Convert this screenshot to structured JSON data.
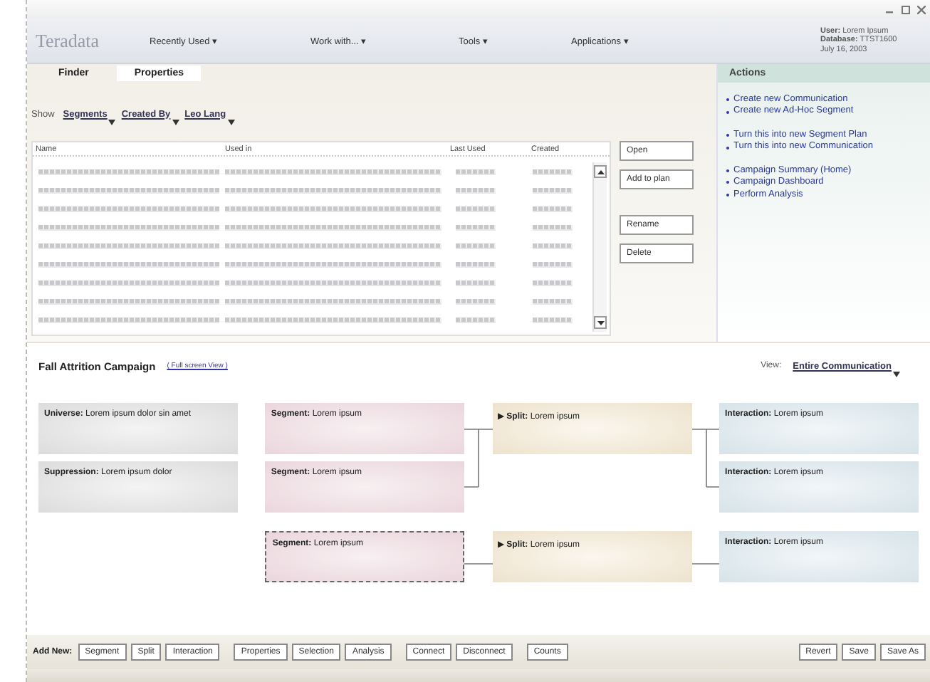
{
  "window": {
    "logo": "Teradata",
    "menus": [
      "Recently Used ▾",
      "Work with... ▾",
      "Tools ▾",
      "Applications ▾"
    ],
    "user_info": [
      "**User:** Lorem Ipsum",
      "**Database:** TTST1600",
      "July 16, 2003"
    ]
  },
  "tabs": [
    {
      "label": "Finder",
      "selected": false
    },
    {
      "label": "Properties",
      "selected": true
    }
  ],
  "filters": {
    "label": "Show",
    "dropdowns": [
      "Segments",
      "Created By",
      "Leo Lang"
    ]
  },
  "table": {
    "columns": [
      "Name",
      "Used in",
      "Last Used",
      "Created"
    ],
    "rows": [
      {
        "kind": "illegible"
      },
      {
        "kind": "illegible"
      },
      {
        "kind": "illegible"
      },
      {
        "kind": "illegible"
      },
      {
        "kind": "illegible"
      },
      {
        "kind": "illegible"
      },
      {
        "kind": "illegible"
      },
      {
        "kind": "illegible"
      },
      {
        "kind": "illegible"
      }
    ]
  },
  "finder_buttons": [
    [
      "Open",
      "Add to plan"
    ],
    [
      "Rename",
      "Delete"
    ]
  ],
  "actions": {
    "title": "Actions",
    "groups": [
      [
        "Create new Communication",
        "Create new Ad-Hoc Segment"
      ],
      [
        "Turn this into new Segment Plan",
        "Turn this into new Communication"
      ],
      [
        "Campaign Summary (Home)",
        "Campaign Dashboard",
        "Perform Analysis"
      ]
    ]
  },
  "diagram": {
    "title": "Fall Attrition Campaign",
    "link": "( Full screen View )",
    "view_label": "View:",
    "view_value": "Entire Communication",
    "rows": [
      [
        {
          "kind": "universe",
          "label": "Universe:",
          "text": "Lorem ipsum dolor sin amet",
          "selected": false
        },
        {
          "kind": "segment",
          "label": "Segment:",
          "text": "Lorem ipsum",
          "selected": false
        },
        {
          "kind": "split",
          "marker": "▶",
          "label": "Split:",
          "text": "Lorem ipsum",
          "selected": false
        },
        {
          "kind": "interaction",
          "label": "Interaction:",
          "text": "Lorem ipsum",
          "selected": false
        }
      ],
      [
        {
          "kind": "suppression",
          "label": "Suppression:",
          "text": "Lorem ipsum dolor",
          "selected": false
        },
        {
          "kind": "segment",
          "label": "Segment:",
          "text": "Lorem ipsum",
          "selected": false
        },
        {
          "kind": "empty"
        },
        {
          "kind": "interaction",
          "label": "Interaction:",
          "text": "Lorem ipsum",
          "selected": false
        }
      ],
      [
        {
          "kind": "empty"
        },
        {
          "kind": "segment",
          "label": "Segment:",
          "text": "Lorem ipsum",
          "selected": true
        },
        {
          "kind": "split",
          "marker": "▶",
          "label": "Split:",
          "text": "Lorem ipsum",
          "selected": false
        },
        {
          "kind": "interaction",
          "label": "Interaction:",
          "text": "Lorem ipsum",
          "selected": false
        }
      ]
    ]
  },
  "toolbar": {
    "label": "Add New:",
    "groups": [
      [
        "Segment",
        "Split",
        "Interaction"
      ],
      [
        "Properties",
        "Selection",
        "Analysis"
      ],
      [
        "Connect",
        "Disconnect"
      ],
      [
        "Counts"
      ]
    ],
    "right": [
      "Revert",
      "Save",
      "Save As"
    ]
  }
}
